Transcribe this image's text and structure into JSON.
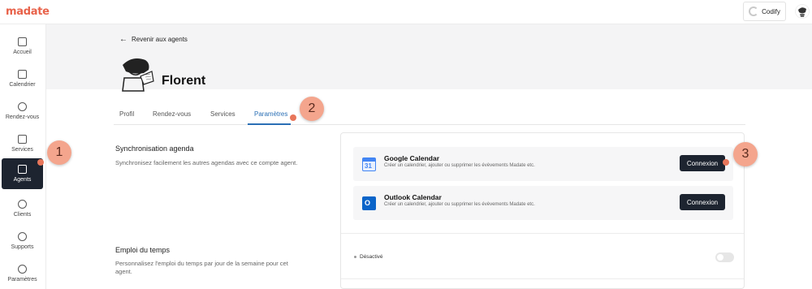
{
  "app": {
    "logo_text": "madate"
  },
  "workspace": {
    "name": "Codify"
  },
  "sidebar": {
    "items": [
      {
        "label": "Accueil",
        "icon": "home-icon"
      },
      {
        "label": "Calendrier",
        "icon": "calendar-icon"
      },
      {
        "label": "Rendez-vous",
        "icon": "clock-icon"
      },
      {
        "label": "Services",
        "icon": "document-icon"
      },
      {
        "label": "Agents",
        "icon": "users-icon",
        "active": true
      },
      {
        "label": "Clients",
        "icon": "user-circle-icon"
      },
      {
        "label": "Supports",
        "icon": "lifebuoy-icon"
      },
      {
        "label": "Paramètres",
        "icon": "gear-icon"
      }
    ]
  },
  "header": {
    "back_label": "Revenir aux agents",
    "agent_name": "Florent"
  },
  "tabs": [
    {
      "label": "Profil"
    },
    {
      "label": "Rendez-vous"
    },
    {
      "label": "Services"
    },
    {
      "label": "Paramètres",
      "active": true
    }
  ],
  "sync": {
    "title": "Synchronisation agenda",
    "description": "Synchronisez facilement les autres agendas avec ce compte agent.",
    "calendars": [
      {
        "name": "Google Calendar",
        "description": "Créer un calendrier, ajouter ou supprimer les évèvements Madate etc.",
        "button": "Connexion",
        "icon_text": "31"
      },
      {
        "name": "Outlook Calendar",
        "description": "Créer un calendrier, ajouter ou supprimer les évèvements Madate etc.",
        "button": "Connexion",
        "icon_text": "O"
      }
    ]
  },
  "schedule": {
    "title": "Emploi du temps",
    "description": "Personnalisez l'emploi du temps par jour de la semaine pour cet agent.",
    "status": "Désactivé",
    "enabled": false
  },
  "markers": [
    "1",
    "2",
    "3"
  ],
  "colors": {
    "brand": "#e8624a",
    "active_nav": "#1d2430",
    "accent_tab": "#2a6fb5",
    "marker": "#f4a58d"
  }
}
